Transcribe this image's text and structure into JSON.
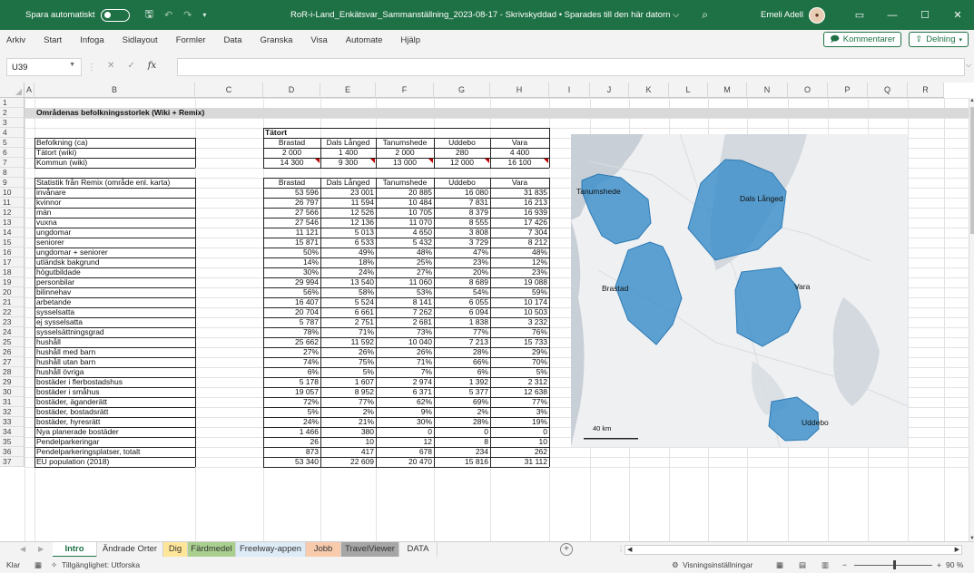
{
  "titlebar": {
    "autosave_label": "Spara automatiskt",
    "document_title": "RoR-i-Land_Enkätsvar_Sammanställning_2023-08-17  -  Skrivskyddad  •  Sparades till den här datorn  ⌵",
    "user_name": "Emeli Adell",
    "search_icon": "search-icon",
    "window_buttons": [
      "▭",
      "—",
      "☐",
      "✕"
    ]
  },
  "menu": {
    "items": [
      "Arkiv",
      "Start",
      "Infoga",
      "Sidlayout",
      "Formler",
      "Data",
      "Granska",
      "Visa",
      "Automate",
      "Hjälp"
    ],
    "comments_label": "Kommentarer",
    "share_label": "Delning"
  },
  "formula_bar": {
    "cell_ref": "U39",
    "fx_label": "fx",
    "value": ""
  },
  "columns": [
    "A",
    "B",
    "C",
    "D",
    "E",
    "F",
    "G",
    "H",
    "I",
    "J",
    "K",
    "L",
    "M",
    "N",
    "O",
    "P",
    "Q",
    "R"
  ],
  "rows": [
    "1",
    "2",
    "3",
    "4",
    "5",
    "6",
    "7",
    "8",
    "9",
    "10",
    "11",
    "12",
    "13",
    "14",
    "15",
    "16",
    "17",
    "18",
    "19",
    "20",
    "21",
    "22",
    "23",
    "24",
    "25",
    "26",
    "27",
    "28",
    "29",
    "30",
    "31",
    "32",
    "33",
    "34",
    "35",
    "36",
    "37"
  ],
  "sheet": {
    "section_title": "Områdenas befolkningsstorlek (Wiki + Remix)",
    "tatort_header": "Tätort",
    "area_names": [
      "Brastad",
      "Dals Långed",
      "Tanumshede",
      "Uddebo",
      "Vara"
    ],
    "population_label": "Befolkning (ca)",
    "population_rows": [
      {
        "label": "Tätort (wiki)",
        "values": [
          "2 000",
          "1 400",
          "2 000",
          "280",
          "4 400"
        ]
      },
      {
        "label": "Kommun (wiki)",
        "values": [
          "14 300",
          "9 300",
          "13 000",
          "12 000",
          "16 100"
        ]
      }
    ],
    "remix_label": "Statistik från Remix (område enl. karta)",
    "remix_rows": [
      {
        "label": "invånare",
        "values": [
          "53 596",
          "23 001",
          "20 885",
          "16 080",
          "31 835"
        ]
      },
      {
        "label": "kvinnor",
        "values": [
          "26 797",
          "11 594",
          "10 484",
          "7 831",
          "16 213"
        ]
      },
      {
        "label": "män",
        "values": [
          "27 566",
          "12 526",
          "10 705",
          "8 379",
          "16 939"
        ]
      },
      {
        "label": "vuxna",
        "values": [
          "27 546",
          "12 136",
          "11 070",
          "8 555",
          "17 426"
        ]
      },
      {
        "label": "ungdomar",
        "values": [
          "11 121",
          "5 013",
          "4 650",
          "3 808",
          "7 304"
        ]
      },
      {
        "label": "seniorer",
        "values": [
          "15 871",
          "6 533",
          "5 432",
          "3 729",
          "8 212"
        ]
      },
      {
        "label": "ungdomar + seniorer",
        "values": [
          "50%",
          "49%",
          "48%",
          "47%",
          "48%"
        ]
      },
      {
        "label": "utländsk bakgrund",
        "values": [
          "14%",
          "18%",
          "25%",
          "23%",
          "12%"
        ]
      },
      {
        "label": "högutbildade",
        "values": [
          "30%",
          "24%",
          "27%",
          "20%",
          "23%"
        ]
      },
      {
        "label": "personbilar",
        "values": [
          "29 994",
          "13 540",
          "11 060",
          "8 689",
          "19 088"
        ]
      },
      {
        "label": "bilinnehav",
        "values": [
          "56%",
          "58%",
          "53%",
          "54%",
          "59%"
        ]
      },
      {
        "label": "arbetande",
        "values": [
          "16 407",
          "5 524",
          "8 141",
          "6 055",
          "10 174"
        ]
      },
      {
        "label": "sysselsatta",
        "values": [
          "20 704",
          "6 661",
          "7 262",
          "6 094",
          "10 503"
        ]
      },
      {
        "label": "ej sysselsatta",
        "values": [
          "5 787",
          "2 751",
          "2 681",
          "1 838",
          "3 232"
        ]
      },
      {
        "label": "sysselsättningsgrad",
        "values": [
          "78%",
          "71%",
          "73%",
          "77%",
          "76%"
        ]
      },
      {
        "label": "hushåll",
        "values": [
          "25 662",
          "11 592",
          "10 040",
          "7 213",
          "15 733"
        ]
      },
      {
        "label": "hushåll med barn",
        "values": [
          "27%",
          "26%",
          "26%",
          "28%",
          "29%"
        ]
      },
      {
        "label": "hushåll utan barn",
        "values": [
          "74%",
          "75%",
          "71%",
          "66%",
          "70%"
        ]
      },
      {
        "label": "hushåll övriga",
        "values": [
          "6%",
          "5%",
          "7%",
          "6%",
          "5%"
        ]
      },
      {
        "label": "bostäder i flerbostadshus",
        "values": [
          "5 178",
          "1 607",
          "2 974",
          "1 392",
          "2 312"
        ]
      },
      {
        "label": "bostäder i småhus",
        "values": [
          "19 057",
          "8 952",
          "6 371",
          "5 377",
          "12 638"
        ]
      },
      {
        "label": "bostäder, äganderätt",
        "values": [
          "72%",
          "77%",
          "62%",
          "69%",
          "77%"
        ]
      },
      {
        "label": "bostäder, bostadsrätt",
        "values": [
          "5%",
          "2%",
          "9%",
          "2%",
          "3%"
        ]
      },
      {
        "label": "bostäder, hyresrätt",
        "values": [
          "24%",
          "21%",
          "30%",
          "28%",
          "19%"
        ]
      },
      {
        "label": "Nya planerade bostäder",
        "values": [
          "1 466",
          "380",
          "0",
          "0",
          "0"
        ]
      },
      {
        "label": "Pendelparkeringar",
        "values": [
          "26",
          "10",
          "12",
          "8",
          "10"
        ]
      },
      {
        "label": "Pendelparkeringsplatser, totalt",
        "values": [
          "873",
          "417",
          "678",
          "234",
          "262"
        ]
      },
      {
        "label": "EU population (2018)",
        "values": [
          "53 340",
          "22 609",
          "20 470",
          "15 816",
          "31 112"
        ]
      }
    ]
  },
  "map": {
    "labels": [
      "Tanumshede",
      "Dals Långed",
      "Brastad",
      "Vara",
      "Uddebo"
    ],
    "scale_label": "40 km",
    "region_color": "#3b8dc9"
  },
  "tabs": [
    {
      "label": "Intro",
      "color": "#ffffff",
      "active": true
    },
    {
      "label": "Ändrade Orter",
      "color": "#f3f3f3",
      "active": false
    },
    {
      "label": "Dig",
      "color": "#ffe699",
      "active": false
    },
    {
      "label": "Färdmedel",
      "color": "#a9d08e",
      "active": false
    },
    {
      "label": "Freelway-appen",
      "color": "#ddebf7",
      "active": false
    },
    {
      "label": "Jobb",
      "color": "#f8cbad",
      "active": false
    },
    {
      "label": "TravelViewer",
      "color": "#a6a6a6",
      "active": false
    },
    {
      "label": "DATA",
      "color": "#f3f3f3",
      "active": false
    }
  ],
  "status": {
    "ready": "Klar",
    "accessibility": "Tillgänglighet: Utforska",
    "display_settings": "Visningsinställningar",
    "zoom": "90 %"
  }
}
